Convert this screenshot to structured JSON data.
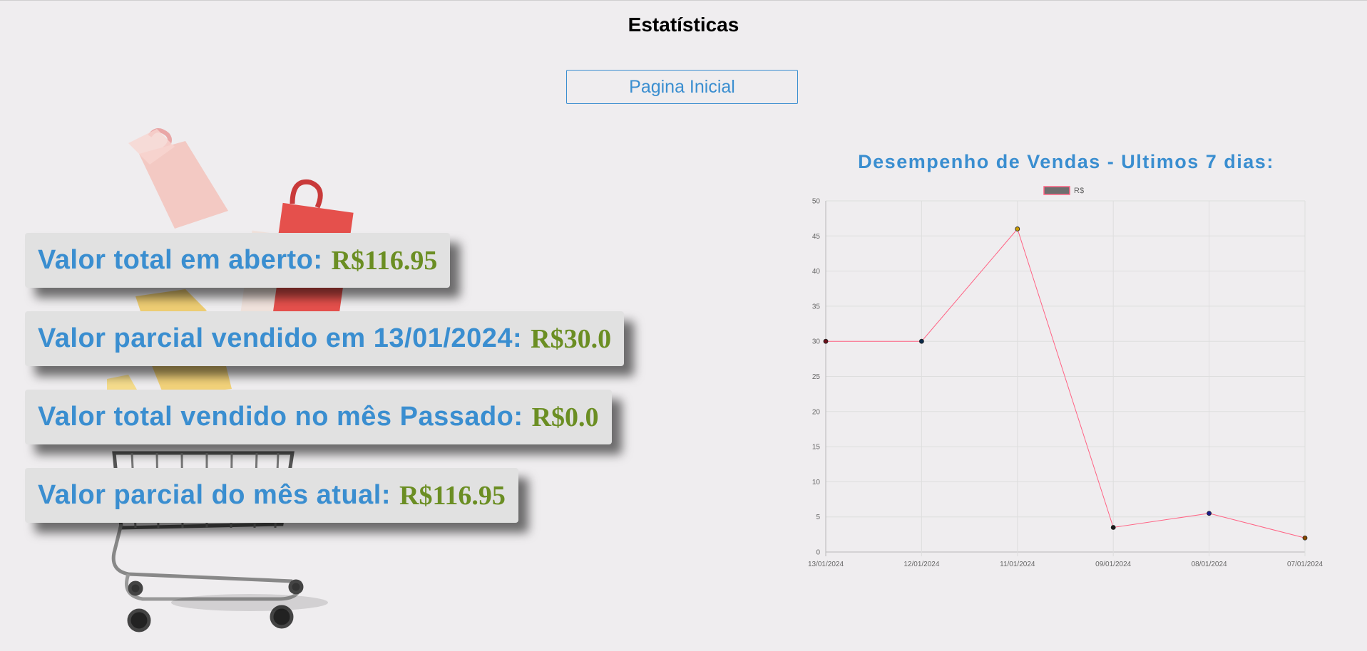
{
  "page": {
    "title": "Estatísticas"
  },
  "nav": {
    "home_label": "Pagina Inicial"
  },
  "stats": [
    {
      "label": "Valor total em aberto:",
      "value": "R$116.95"
    },
    {
      "label": "Valor parcial vendido em 13/01/2024:",
      "value": "R$30.0"
    },
    {
      "label": "Valor total vendido no mês Passado:",
      "value": "R$0.0"
    },
    {
      "label": "Valor parcial do mês atual:",
      "value": "R$116.95"
    }
  ],
  "colors": {
    "accent": "#3a8ed0",
    "value_green": "#6b8e23",
    "line": "#ff6384",
    "background": "#efedef"
  },
  "chart_data": {
    "type": "line",
    "title": "Desempenho de Vendas - Ultimos 7 dias:",
    "categories": [
      "13/01/2024",
      "12/01/2024",
      "11/01/2024",
      "09/01/2024",
      "08/01/2024",
      "07/01/2024"
    ],
    "series": [
      {
        "name": "R$",
        "values": [
          30,
          30,
          46,
          3.5,
          5.5,
          2
        ],
        "point_colors": [
          "#6b0f1a",
          "#0a2a4a",
          "#c89a00",
          "#1a1a1a",
          "#1a1a8a",
          "#8a4a00"
        ]
      }
    ],
    "ylim": [
      0,
      50
    ],
    "yticks": [
      0,
      5,
      10,
      15,
      20,
      25,
      30,
      35,
      40,
      45,
      50
    ],
    "grid": true,
    "legend": "top"
  }
}
